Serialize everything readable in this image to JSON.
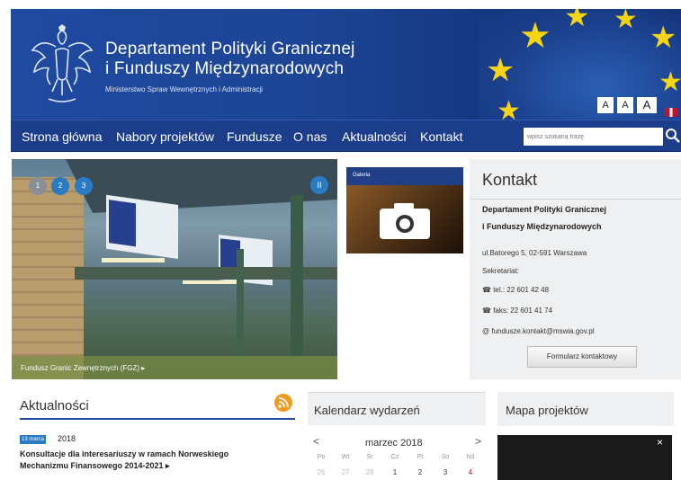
{
  "header": {
    "title_line1": "Departament Polityki Granicznej",
    "title_line2": "i Funduszy Międzynarodowych",
    "subtitle": "Ministerstwo Spraw Wewnętrznych i Administracji",
    "font_buttons": [
      "A",
      "A",
      "A"
    ]
  },
  "nav": {
    "items": [
      "Strona główna",
      "Nabory projektów",
      "Fundusze",
      "O nas",
      "Aktualności",
      "Kontakt"
    ],
    "search_placeholder": "wpisz szukaną frazę"
  },
  "slider": {
    "dots": [
      "1",
      "2",
      "3"
    ],
    "pause": "II",
    "caption": "Fundusz Granic Zewnętrznych (FGZ) ▸"
  },
  "gallery": {
    "label": "Galeria"
  },
  "contact": {
    "title": "Kontakt",
    "org_line1": "Departament Polityki Granicznej",
    "org_line2": "i Funduszy Międzynarodowych",
    "address": "ul.Batorego 5, 02-591 Warszawa",
    "secretariat": "Sekretariat:",
    "tel": "tel.: 22 601 42 48",
    "fax": "faks: 22 601 41 74",
    "email": "fundusze.kontakt@mswia.gov.pl",
    "form_button": "Formularz kontaktowy"
  },
  "news": {
    "title": "Aktualności",
    "date_badge": "13 marca",
    "year": "2018",
    "headline_line1": "Konsultacje dla interesariuszy w ramach Norweskiego",
    "headline_line2": "Mechanizmu Finansowego 2014-2021 ▸"
  },
  "calendar": {
    "title": "Kalendarz wydarzeń",
    "month": "marzec 2018",
    "prev": "<",
    "next": ">",
    "weekdays": [
      "Po",
      "Wt",
      "Śr",
      "Cz",
      "Pt",
      "So",
      "Nd"
    ],
    "days": [
      "26",
      "27",
      "28",
      "1",
      "2",
      "3",
      "4"
    ]
  },
  "map": {
    "title": "Mapa projektów",
    "close": "×"
  },
  "colors": {
    "primary": "#1f4aa0",
    "nav": "#1c3d8a",
    "star": "#f7d412",
    "rss": "#f29a1e",
    "sunday": "#d0021b"
  }
}
